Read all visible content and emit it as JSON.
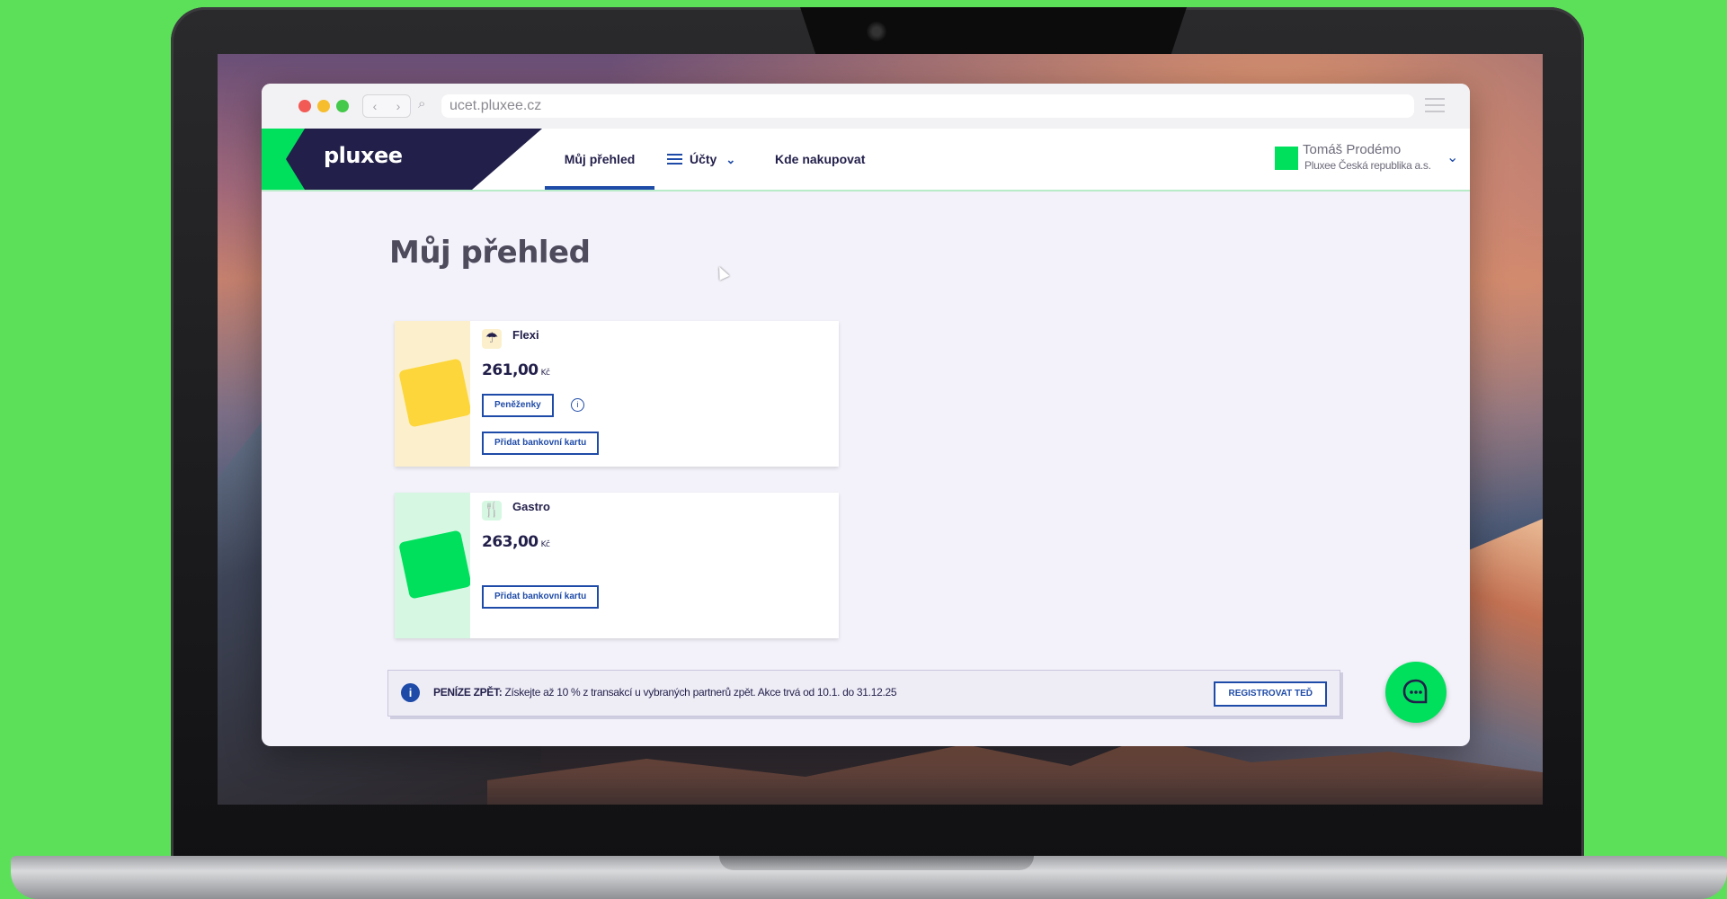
{
  "browser": {
    "url": "ucet.pluxee.cz",
    "back_glyph": "‹",
    "forward_glyph": "›",
    "search_glyph": "⌕"
  },
  "header": {
    "logo": "pluxee",
    "nav": [
      {
        "label": "Můj přehled",
        "active": true
      },
      {
        "label": "Účty",
        "chevron": "⌄"
      },
      {
        "label": "Kde nakupovat"
      }
    ],
    "user": {
      "name": "Tomáš Prodémo",
      "company": "Pluxee Česká republika a.s.",
      "chevron": "⌄"
    }
  },
  "main": {
    "title": "Můj přehled",
    "cards": [
      {
        "name": "Flexi",
        "icon": "umbrella-icon",
        "icon_glyph": "☂",
        "amount": "261,00",
        "currency": "Kč",
        "wallets_button": "Peněženky",
        "info_glyph": "i",
        "add_card_button": "Přidat bankovní kartu",
        "color": "#fcd63a"
      },
      {
        "name": "Gastro",
        "icon": "cutlery-icon",
        "icon_glyph": "🍴",
        "amount": "263,00",
        "currency": "Kč",
        "add_card_button": "Přidat bankovní kartu",
        "color": "#00e05c"
      }
    ]
  },
  "promo": {
    "icon_glyph": "i",
    "label": "PENÍZE ZPĚT:",
    "text": " Získejte až 10 % z transakcí u vybraných partnerů zpět. Akce trvá od 10.1. do 31.12.25",
    "button": "REGISTROVAT TEĎ"
  },
  "colors": {
    "brand_dark": "#221f4a",
    "brand_green": "#00e05c",
    "accent_blue": "#1f4ba8",
    "background": "#5ce05a"
  }
}
